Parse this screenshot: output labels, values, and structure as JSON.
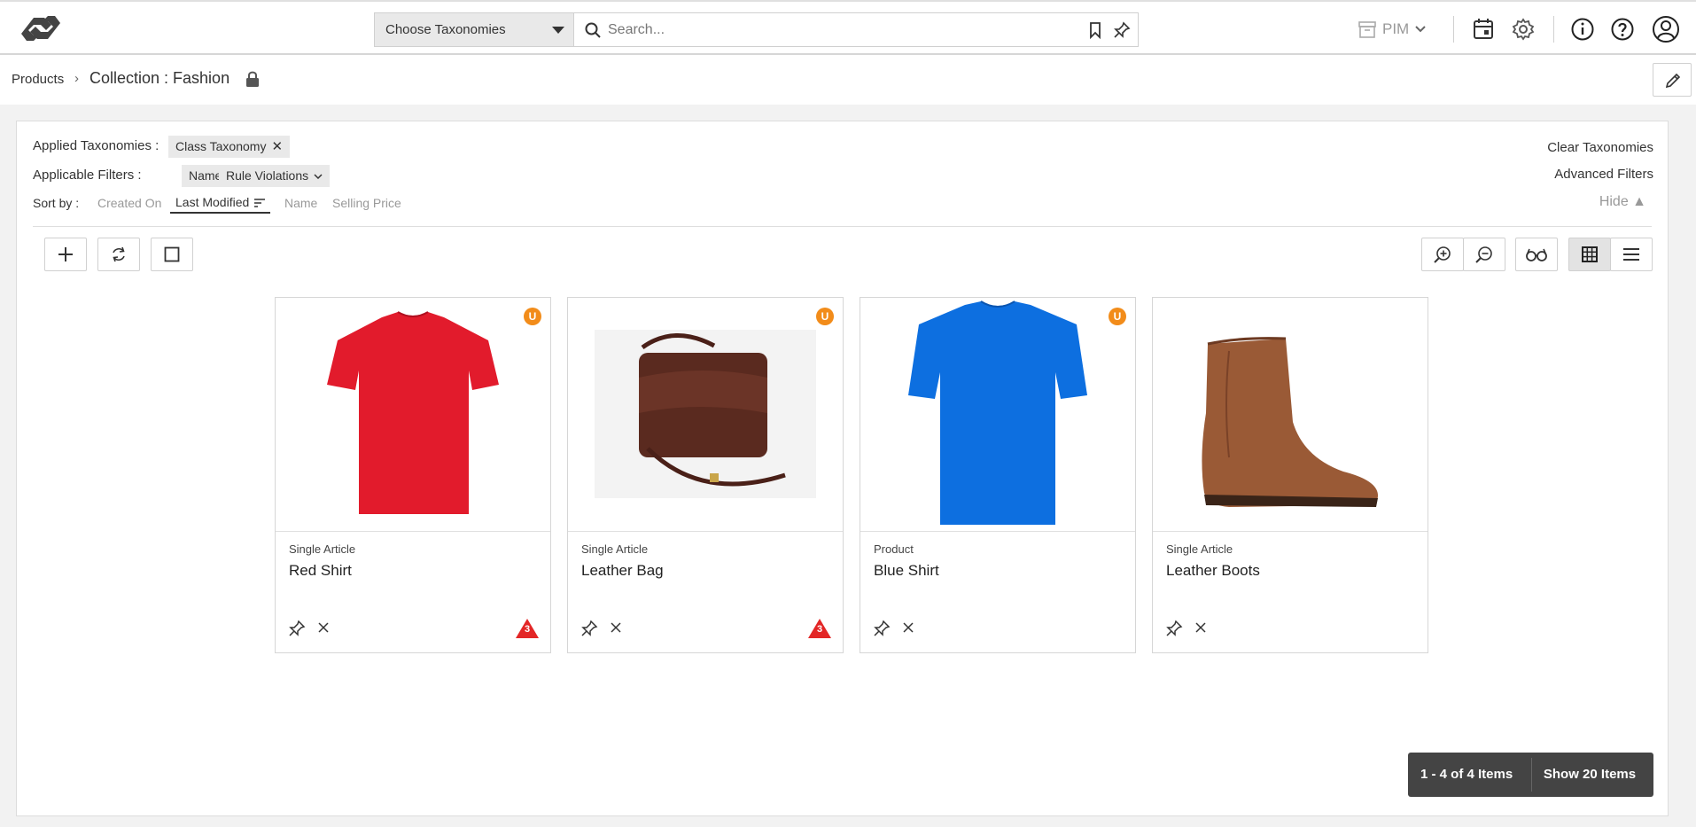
{
  "topbar": {
    "taxonomy_select": "Choose Taxonomies",
    "search_placeholder": "Search...",
    "pim_label": "PIM"
  },
  "breadcrumb": {
    "link": "Products",
    "separator": "›",
    "title": "Collection : Fashion"
  },
  "filters": {
    "applied_taxonomies_label": "Applied Taxonomies :",
    "applied_chip": "Class Taxonomy",
    "applicable_filters_label": "Applicable Filters :",
    "filter_chips": [
      "Name",
      "Rule Violations"
    ],
    "clear_taxonomies": "Clear Taxonomies",
    "advanced_filters": "Advanced Filters",
    "sort_label": "Sort by :",
    "sort_options": [
      "Created On",
      "Last Modified",
      "Name",
      "Selling Price"
    ],
    "sort_active": "Last Modified",
    "hide": "Hide ▲"
  },
  "products": [
    {
      "type": "Single Article",
      "name": "Red Shirt",
      "badge": "U",
      "violations": "3",
      "color": "#e21b2c"
    },
    {
      "type": "Single Article",
      "name": "Leather Bag",
      "badge": "U",
      "violations": "3",
      "color": "#5a2a1f"
    },
    {
      "type": "Product",
      "name": "Blue Shirt",
      "badge": "U",
      "violations": "",
      "color": "#0d6fe0"
    },
    {
      "type": "Single Article",
      "name": "Leather Boots",
      "badge": "",
      "violations": "",
      "color": "#9a5a36"
    }
  ],
  "pager": {
    "count": "1 - 4 of 4 Items",
    "show": "Show 20 Items"
  }
}
